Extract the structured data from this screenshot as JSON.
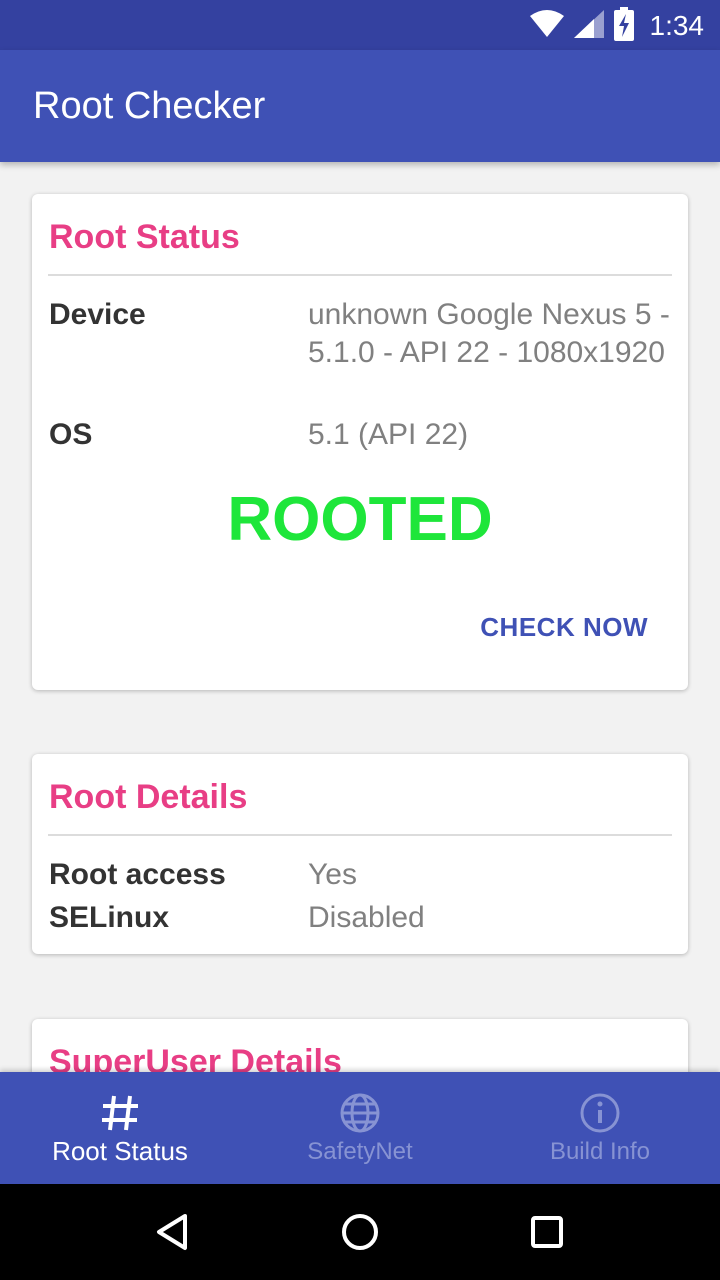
{
  "status_bar": {
    "time": "1:34",
    "icons": [
      "wifi-icon",
      "signal-icon",
      "battery-charging-icon"
    ]
  },
  "app": {
    "title": "Root Checker"
  },
  "root_status_card": {
    "title": "Root Status",
    "rows": [
      {
        "label": "Device",
        "value": "unknown Google Nexus 5 - 5.1.0 - API 22 - 1080x1920"
      },
      {
        "label": "OS",
        "value": "5.1 (API 22)"
      }
    ],
    "result": "ROOTED",
    "result_color": "#1ee63a",
    "action_label": "CHECK NOW"
  },
  "root_details_card": {
    "title": "Root Details",
    "rows": [
      {
        "label": "Root access",
        "value": "Yes"
      },
      {
        "label": "SELinux",
        "value": "Disabled"
      }
    ]
  },
  "superuser_card": {
    "title": "SuperUser Details"
  },
  "bottom_nav": {
    "items": [
      {
        "label": "Root Status",
        "icon": "hash-icon",
        "active": true
      },
      {
        "label": "SafetyNet",
        "icon": "globe-icon",
        "active": false
      },
      {
        "label": "Build Info",
        "icon": "info-icon",
        "active": false
      }
    ]
  },
  "colors": {
    "primary": "#3f51b5",
    "primary_dark": "#3441a0",
    "accent": "#e83e85"
  }
}
